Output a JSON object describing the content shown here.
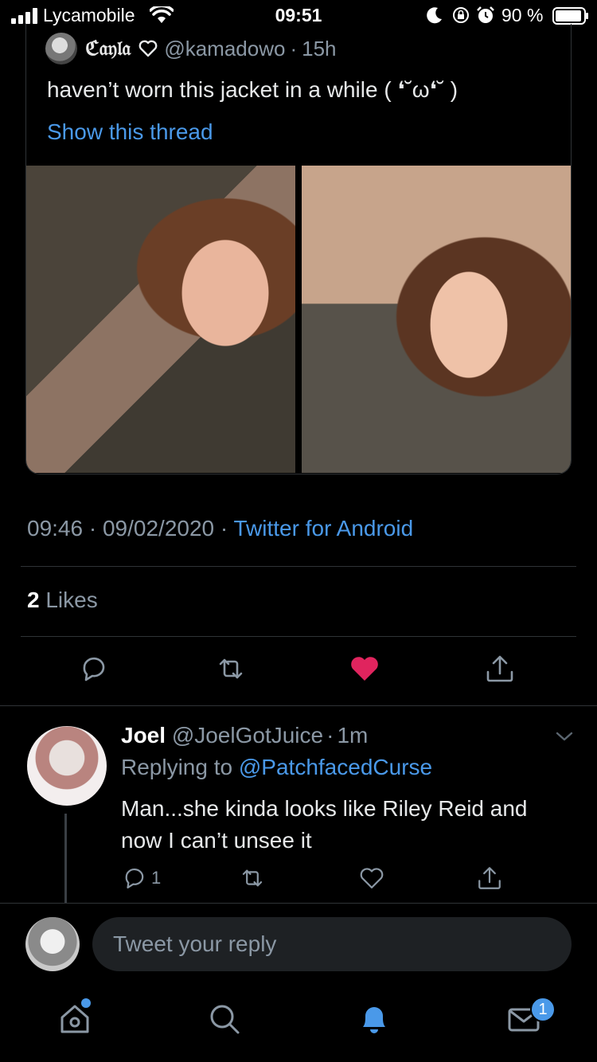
{
  "status_bar": {
    "carrier": "Lycamobile",
    "time": "09:51",
    "battery_percent": "90 %",
    "icons": [
      "signal-icon",
      "wifi-icon",
      "moon-icon",
      "rotation-lock-icon",
      "alarm-icon",
      "battery-icon"
    ]
  },
  "quoted_tweet": {
    "display_name": "ℭ𝔞𝔶𝔩𝔞",
    "handle": "@kamadowo",
    "separator": "·",
    "age": "15h",
    "text": "haven’t worn this jacket in a while ( ❛˘ω❛˘ )",
    "show_thread": "Show this thread"
  },
  "tweet_meta": {
    "time": "09:46",
    "dot1": " · ",
    "date": "09/02/2020",
    "dot2": " · ",
    "source": "Twitter for Android"
  },
  "likes": {
    "count": "2",
    "label": "Likes"
  },
  "actions": {
    "icons": [
      "reply-icon",
      "retweet-icon",
      "like-icon",
      "share-icon"
    ],
    "liked": true,
    "like_color": "#e0245e"
  },
  "reply": {
    "display_name": "Joel",
    "handle": "@JoelGotJuice",
    "separator": "·",
    "age": "1m",
    "replying_prefix": "Replying to",
    "replying_to": "@PatchfacedCurse",
    "text": "Man...she kinda looks like Riley Reid and now I can’t unsee it",
    "reply_count": "1"
  },
  "composer": {
    "placeholder": "Tweet your reply"
  },
  "tab_bar": {
    "tabs": [
      "home-icon",
      "search-icon",
      "notifications-icon",
      "messages-icon"
    ],
    "active": "notifications-icon",
    "messages_badge": "1",
    "accent": "#4a99e9"
  }
}
